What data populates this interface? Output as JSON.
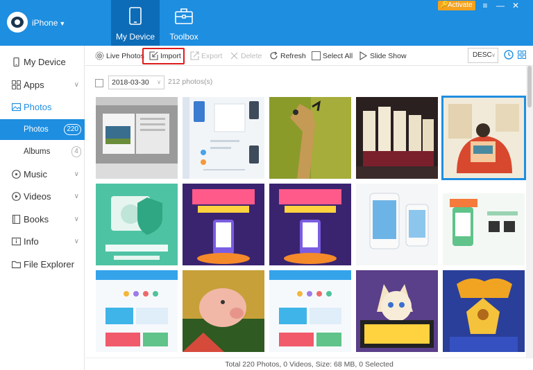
{
  "header": {
    "device_name": "iPhone",
    "tabs": [
      {
        "label": "My Device",
        "icon": "tablet-icon",
        "active": true
      },
      {
        "label": "Toolbox",
        "icon": "toolbox-icon",
        "active": false
      }
    ],
    "activate_label": "Activate",
    "accent_color": "#1e8ee0"
  },
  "sidebar": {
    "items": [
      {
        "label": "My Device",
        "icon": "phone-icon"
      },
      {
        "label": "Apps",
        "icon": "apps-icon"
      },
      {
        "label": "Photos",
        "icon": "image-icon",
        "expanded": true
      },
      {
        "label": "Photos",
        "count": "220",
        "active": true
      },
      {
        "label": "Albums",
        "count": "4"
      },
      {
        "label": "Music",
        "icon": "music-icon"
      },
      {
        "label": "Videos",
        "icon": "play-icon"
      },
      {
        "label": "Books",
        "icon": "book-icon"
      },
      {
        "label": "Info",
        "icon": "info-icon"
      },
      {
        "label": "File Explorer",
        "icon": "folder-icon"
      }
    ]
  },
  "toolbar": {
    "live_photos": "Live Photos",
    "import": "Import",
    "export": "Export",
    "delete": "Delete",
    "refresh": "Refresh",
    "select_all": "Select All",
    "slide_show": "Slide Show",
    "sort": "DESC"
  },
  "content": {
    "date": "2018-03-30",
    "photo_count": "212 photos(s)"
  },
  "status": "Total 220 Photos, 0 Videos, Size: 68 MB, 0 Selected"
}
